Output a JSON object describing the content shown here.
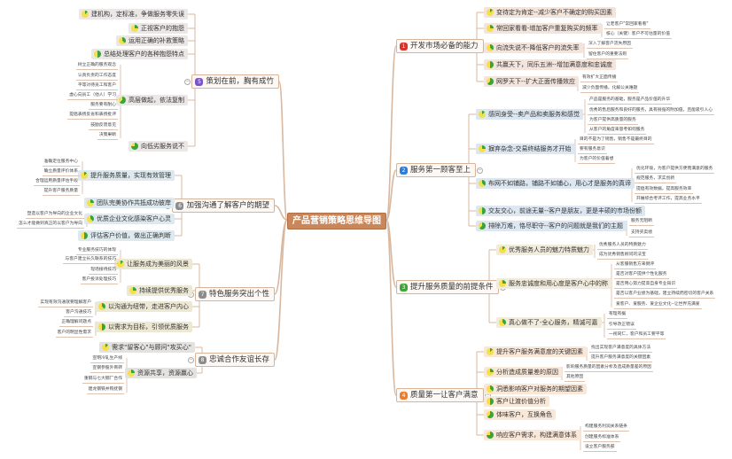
{
  "title": "产品营销策略思维导图",
  "colors": {
    "line": "#d9b8a0",
    "pie_bg": "#f3e04a",
    "pie_fill": "#3aa33a"
  },
  "branches": [
    {
      "num": "1",
      "label": "开发市场必备的能力",
      "badge_color": "#d8342c",
      "kid_bg": "#f3e4dc",
      "side": "right",
      "children": [
        {
          "label": "变待定为肯定--减少客户不确定的购买因素",
          "progress": 0.125,
          "leaves": []
        },
        {
          "label": "常回家看看-增加客户重复购买的频率",
          "progress": 0.25,
          "leaves": [
            "让老客户\"常回家看看\"",
            "核心（关键）客户不可估量的价值"
          ]
        },
        {
          "label": "向流失说不-降低客户的流失率",
          "progress": 0.375,
          "leaves": [
            "深入了解客户流失原因",
            "留住客户的重要法则"
          ]
        },
        {
          "label": "共赢天下，同乐五洲--增加满意度和忠诚度",
          "progress": 0.5,
          "leaves": []
        },
        {
          "label": "网罗天下--扩大正面传播效应",
          "progress": 0.625,
          "leaves": [
            "有效扩大正面传播",
            "减少负面传播，化解公关难题"
          ]
        }
      ]
    },
    {
      "num": "2",
      "label": "服务第一顾客至上",
      "badge_color": "#2e7dd6",
      "kid_bg": "#dde7f1",
      "side": "right",
      "children": [
        {
          "label": "感同身受--卖产品和卖服务和感觉",
          "progress": 0.125,
          "leaves": [
            "产品是服务的基础，服务是产品价值的升华",
            "优秀的售后服务和良好的服务，具有很强的附加值，且能吸引人心",
            "为客户提供高质量的服务",
            "从客户的角度来思考如何服务"
          ]
        },
        {
          "label": "摒弃杂念-交易终结服务才开始",
          "progress": 0.25,
          "leaves": [
            "目的不是为了销售，销售不是最终目的",
            "要有服务意识",
            "为客户的价值着想"
          ]
        },
        {
          "label": "布网不如铺路，铺路不如铺心，用心才是服务的真谛",
          "progress": 0.375,
          "leaves": [
            "优化环境，为客户提供方便而满意的服务",
            "规范服务，求实创新",
            "提倡有效数据，提高服务效率",
            "开展综合考评工作，提高业务水平"
          ]
        },
        {
          "label": "交友交心，前途无量--客户是朋友，更是丰硕的市场份额",
          "progress": 0.5,
          "leaves": []
        },
        {
          "label": "排除万难，恪尽职守--客户的问题就是我们的主题",
          "progress": 0.625,
          "leaves": [
            "服务无阻断",
            "支持买卖绩"
          ]
        }
      ]
    },
    {
      "num": "3",
      "label": "提升服务质量的前提条件",
      "badge_color": "#3da63a",
      "kid_bg": "#f1ebdb",
      "side": "right",
      "children": [
        {
          "label": "优秀服务人员的魅力特质魅力",
          "progress": 0.125,
          "leaves": [
            "优秀服务人员的特质魅力",
            "成为优秀销售顾问的法宝"
          ]
        },
        {
          "label": "服务忠诚度和用心度是客户心中的称",
          "progress": 0.25,
          "leaves": [
            "从客服销售方来倒评",
            "是否对客户提供个性化服务",
            "是否用心努力提高自身专业知识",
            "是否以客户业绩为基础，建立持续而密切的客户关系",
            "爱客户、爱服务、爱企业文化--让世界充满爱"
          ]
        },
        {
          "label": "真心做不了-全心服务，精诚可嘉",
          "progress": 0.375,
          "leaves": [
            "有理有据",
            "引导改正错误",
            "一视同仁，客户和员工要平等"
          ]
        }
      ]
    },
    {
      "num": "4",
      "label": "质量第一让客户满意",
      "badge_color": "#ee7d2a",
      "kid_bg": "#f9e7d8",
      "side": "right",
      "children": [
        {
          "label": "提升客户服务满意度的关键因素",
          "progress": 0.125,
          "leaves": [
            "找出实现客户满意度的具体方法",
            "提升客户服务满意度的关键因素"
          ]
        },
        {
          "label": "分析造成质量差的原因",
          "progress": 0.25,
          "leaves": [
            "影响服务质量的因素分析及造成质量差的原因",
            "其他原因"
          ]
        },
        {
          "label": "洞悉影响客户对服务的期望因素",
          "progress": 0.375,
          "leaves": []
        },
        {
          "label": "客户让渡价值分析",
          "progress": 0.5,
          "leaves": []
        },
        {
          "label": "体味客户，互换角色",
          "progress": 0.625,
          "leaves": []
        },
        {
          "label": "响应客户需求，构建满意体系",
          "progress": 0.75,
          "leaves": [
            "构建服务利润关系链条",
            "创建服务标准体系",
            "设立客户服务部"
          ]
        }
      ]
    },
    {
      "num": "5",
      "label": "策划在前，胸有成竹",
      "badge_color": "#7b55c8",
      "kid_bg": "#ebe7e6",
      "side": "left",
      "children": [
        {
          "label": "建机构，定标准，争做服务零失误",
          "progress": 0.125,
          "leaves": []
        },
        {
          "label": "正视客户的抱怨",
          "progress": 0.25,
          "leaves": []
        },
        {
          "label": "运用正确的补救策略",
          "progress": 0.375,
          "leaves": []
        },
        {
          "label": "总结处理客户的各种抱怨特点",
          "progress": 0.5,
          "leaves": []
        },
        {
          "label": "高层做起，依法复制",
          "progress": 0.625,
          "leaves": [
            "树立正确的服务观念",
            "认真负责的工作态度",
            "平等对待员工和客户",
            "虚心向员工（他人）学习",
            "服务要有耐心",
            "提倡表扬反省和表扬批评",
            "鼓励反馈意见",
            "决策果断"
          ]
        },
        {
          "label": "向低劣服务说不",
          "progress": 0.75,
          "leaves": []
        }
      ]
    },
    {
      "num": "6",
      "label": "加强沟通了解客户的期望",
      "badge_color": "#8c8c8c",
      "kid_bg": "#dde9ee",
      "side": "left",
      "children": [
        {
          "label": "提升服务质量，实现有效管理",
          "progress": 0.125,
          "leaves": [
            "准确定位服务中心",
            "确立质量评价体系",
            "合理运用质量评估手段",
            "提升客户服务质量"
          ]
        },
        {
          "label": "团队完美协作共抵成功彼岸",
          "progress": 0.25,
          "leaves": []
        },
        {
          "label": "优质企业文化感染客户心灵",
          "progress": 0.375,
          "leaves": [
            "塑造以客户为导向的企业文化",
            "怎么才能做到真正的以客户为导向"
          ]
        },
        {
          "label": "评估客户价值，做出正确判断",
          "progress": 0.5,
          "leaves": []
        }
      ]
    },
    {
      "num": "7",
      "label": "特色服务突出个性",
      "badge_color": "#8c8c8c",
      "kid_bg": "#ede8d4",
      "side": "left",
      "children": [
        {
          "label": "让服务成为美丽的风景",
          "progress": 0.125,
          "leaves": [
            "专业服务技巧的体现",
            "与客户建立长久联系的技巧",
            "现场接待技巧",
            "客户投诉处理技巧"
          ]
        },
        {
          "label": "持续提供优秀服务",
          "progress": 0.25,
          "leaves": []
        },
        {
          "label": "以沟通为纽带，走进客户内心",
          "progress": 0.375,
          "leaves": [
            "实现有效沟通就要理解客户",
            "客户沟通技巧"
          ]
        },
        {
          "label": "以需求为目标，引领优质服务",
          "progress": 0.5,
          "leaves": [
            "正确理解问题点",
            "客户的明显性需求"
          ]
        }
      ]
    },
    {
      "num": "8",
      "label": "忠诚合作友谊长存",
      "badge_color": "#8c8c8c",
      "kid_bg": "#e4e2e0",
      "side": "left",
      "children": [
        {
          "label": "需求\"留客心\"与顾问\"攻买心\"",
          "progress": 0.125,
          "leaves": []
        },
        {
          "label": "资源共享，资源赢心",
          "progress": 0.25,
          "leaves": [
            "宣明冷轧生产线",
            "宣钢参股外商转",
            "重钢与七大钢厂合作",
            "建龙钢铁并购抚钢"
          ]
        }
      ]
    }
  ]
}
